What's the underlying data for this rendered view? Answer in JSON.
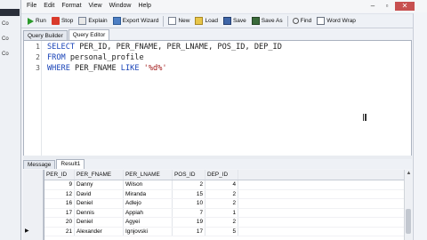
{
  "left_panel": {
    "fragments": [
      "Co",
      "Co",
      "Co"
    ]
  },
  "menu": [
    {
      "label": "File"
    },
    {
      "label": "Edit"
    },
    {
      "label": "Format"
    },
    {
      "label": "View"
    },
    {
      "label": "Window"
    },
    {
      "label": "Help"
    }
  ],
  "window_controls": {
    "minimize": "–",
    "maximize": "▫",
    "close": "✕"
  },
  "toolbar": {
    "run": "Run",
    "stop": "Stop",
    "explain": "Explain",
    "export": "Export Wizard",
    "new": "New",
    "load": "Load",
    "save": "Save",
    "save_as": "Save As",
    "find": "Find",
    "word_wrap": "Word Wrap"
  },
  "tabs_top": [
    {
      "label": "Query Builder"
    },
    {
      "label": "Query Editor"
    }
  ],
  "editor": {
    "lines": [
      {
        "num": "1",
        "kw": "SELECT",
        "rest": " PER_ID, PER_FNAME, PER_LNAME, POS_ID, DEP_ID"
      },
      {
        "num": "2",
        "kw": "FROM",
        "rest": " personal_profile"
      },
      {
        "num": "3",
        "kw": "WHERE",
        "rest": " PER_FNAME ",
        "kw2": "LIKE",
        "str": " '%d%'"
      }
    ]
  },
  "tabs_bottom": [
    {
      "label": "Message"
    },
    {
      "label": "Result1"
    }
  ],
  "grid": {
    "columns": [
      "PER_ID",
      "PER_FNAME",
      "PER_LNAME",
      "POS_ID",
      "DEP_ID"
    ],
    "rows": [
      [
        "9",
        "Danny",
        "Wilson",
        "2",
        "4"
      ],
      [
        "12",
        "David",
        "Miranda",
        "15",
        "2"
      ],
      [
        "16",
        "Deniel",
        "Adlejo",
        "10",
        "2"
      ],
      [
        "17",
        "Dennis",
        "Appiah",
        "7",
        "1"
      ],
      [
        "20",
        "Deniel",
        "Agyei",
        "19",
        "2"
      ],
      [
        "21",
        "Alexander",
        "Ignjovski",
        "17",
        "5"
      ]
    ],
    "current_row_marker": "▶"
  },
  "scrollbar": {
    "up": "▲",
    "down": "▼"
  }
}
